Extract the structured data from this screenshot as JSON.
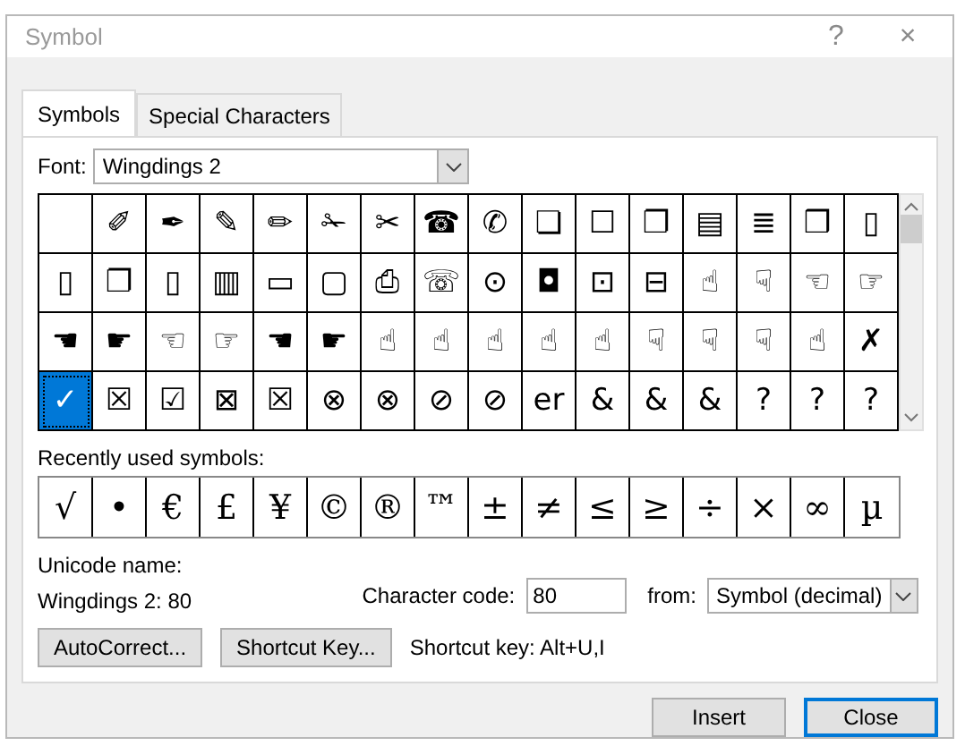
{
  "window": {
    "title": "Symbol",
    "help": "?",
    "close": "×"
  },
  "tabs": [
    {
      "label": "Symbols",
      "selected": true
    },
    {
      "label": "Special Characters",
      "selected": false
    }
  ],
  "font": {
    "label": "Font:",
    "value": "Wingdings 2"
  },
  "grid": [
    [
      {
        "selected": false
      },
      {
        "glyph": "✐",
        "selected": false
      },
      {
        "glyph": "✒",
        "selected": false
      },
      {
        "glyph": "✎",
        "selected": false
      },
      {
        "glyph": "✏",
        "selected": false
      },
      {
        "glyph": "✁",
        "selected": false
      },
      {
        "glyph": "✂",
        "selected": false
      },
      {
        "glyph": "☎",
        "selected": false
      },
      {
        "glyph": "✆",
        "selected": false
      },
      {
        "glyph": "❏",
        "selected": false
      },
      {
        "glyph": "☐",
        "selected": false
      },
      {
        "glyph": "❐",
        "selected": false
      },
      {
        "glyph": "▤",
        "selected": false
      },
      {
        "glyph": "≣",
        "selected": false
      },
      {
        "glyph": "❒",
        "selected": false
      },
      {
        "glyph": "▯",
        "selected": false
      }
    ],
    [
      {
        "glyph": "▯",
        "selected": false
      },
      {
        "glyph": "❐",
        "selected": false
      },
      {
        "glyph": "▯",
        "selected": false
      },
      {
        "glyph": "▥",
        "selected": false
      },
      {
        "glyph": "▭",
        "selected": false
      },
      {
        "glyph": "▢",
        "selected": false
      },
      {
        "glyph": "⎙",
        "selected": false
      },
      {
        "glyph": "☏",
        "selected": false
      },
      {
        "glyph": "⊙",
        "selected": false
      },
      {
        "glyph": "◘",
        "selected": false
      },
      {
        "glyph": "⊡",
        "selected": false
      },
      {
        "glyph": "⊟",
        "selected": false
      },
      {
        "glyph": "☝",
        "selected": false
      },
      {
        "glyph": "☟",
        "selected": false
      },
      {
        "glyph": "☜",
        "selected": false
      },
      {
        "glyph": "☞",
        "selected": false
      }
    ],
    [
      {
        "glyph": "☚",
        "selected": false
      },
      {
        "glyph": "☛",
        "selected": false
      },
      {
        "glyph": "☜",
        "selected": false
      },
      {
        "glyph": "☞",
        "selected": false
      },
      {
        "glyph": "☚",
        "selected": false
      },
      {
        "glyph": "☛",
        "selected": false
      },
      {
        "glyph": "☝",
        "selected": false
      },
      {
        "glyph": "☝",
        "selected": false
      },
      {
        "glyph": "☝",
        "selected": false
      },
      {
        "glyph": "☝",
        "selected": false
      },
      {
        "glyph": "☝",
        "selected": false
      },
      {
        "glyph": "☟",
        "selected": false
      },
      {
        "glyph": "☟",
        "selected": false
      },
      {
        "glyph": "☟",
        "selected": false
      },
      {
        "glyph": "☝",
        "selected": false
      },
      {
        "glyph": "✗",
        "selected": false
      }
    ],
    [
      {
        "glyph": "✓",
        "selected": true
      },
      {
        "glyph": "☒",
        "selected": false
      },
      {
        "glyph": "☑",
        "selected": false
      },
      {
        "glyph": "⊠",
        "selected": false
      },
      {
        "glyph": "☒",
        "selected": false
      },
      {
        "glyph": "⊗",
        "selected": false
      },
      {
        "glyph": "⊗",
        "selected": false
      },
      {
        "glyph": "⊘",
        "selected": false
      },
      {
        "glyph": "⊘",
        "selected": false
      },
      {
        "glyph": "er",
        "selected": false
      },
      {
        "glyph": "&",
        "selected": false
      },
      {
        "glyph": "&",
        "selected": false
      },
      {
        "glyph": "&",
        "selected": false
      },
      {
        "glyph": "?",
        "selected": false
      },
      {
        "glyph": "?",
        "selected": false
      },
      {
        "glyph": "?",
        "selected": false
      }
    ]
  ],
  "recent": {
    "label": "Recently used symbols:",
    "symbols": [
      "√",
      "•",
      "€",
      "£",
      "¥",
      "©",
      "®",
      "™",
      "±",
      "≠",
      "≤",
      "≥",
      "÷",
      "×",
      "∞",
      "µ"
    ]
  },
  "unicode_name": {
    "label": "Unicode name:",
    "value": "Wingdings 2: 80"
  },
  "character_code": {
    "label": "Character code:",
    "value": "80"
  },
  "from": {
    "label": "from:",
    "value": "Symbol (decimal)"
  },
  "buttons": [
    {
      "label": "AutoCorrect..."
    },
    {
      "label": "Shortcut Key..."
    }
  ],
  "shortcut": "Shortcut key: Alt+U,I",
  "footer_buttons": [
    {
      "label": "Insert",
      "default": false
    },
    {
      "label": "Close",
      "default": true
    }
  ]
}
